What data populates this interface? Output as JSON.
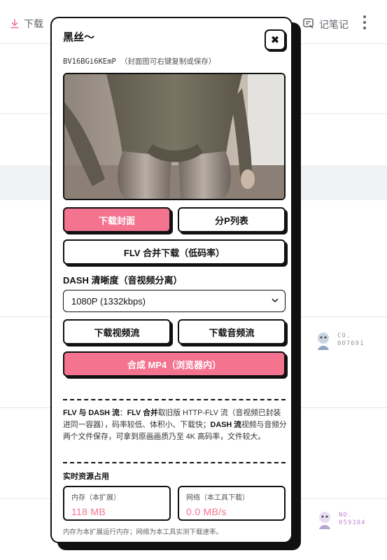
{
  "background": {
    "download_label": "下载",
    "notes_label": "记笔记",
    "badges": [
      {
        "line1": "CO.",
        "line2": "007691",
        "color": "#9499a0"
      },
      {
        "line1": "NO.",
        "line2": "059384",
        "color": "#c48ad8"
      }
    ]
  },
  "panel": {
    "title": "黑丝～",
    "close_symbol": "✖",
    "bvid": "BV16BGi6KEmP",
    "bvid_hint": "（封面图可右键复制或保存）",
    "buttons": {
      "download_cover": "下载封面",
      "p_list": "分P列表",
      "flv_merge": "FLV 合并下载（低码率）",
      "video_stream": "下载视频流",
      "audio_stream": "下载音频流",
      "compose_mp4": "合成 MP4（浏览器内）"
    },
    "dash_label": "DASH 清晰度（音视频分离）",
    "quality_selected": "1080P (1332kbps)",
    "note": {
      "t1": "FLV 与 DASH 流",
      "t2": "：",
      "t3": "FLV 合并",
      "t4": "取旧版 HTTP-FLV 流（音视频已封装进同一容器），码率较低、体积小、下载快；",
      "t5": "DASH 流",
      "t6": "视频与音频分两个文件保存，可拿到原画画质乃至 4K 高码率，文件较大。"
    },
    "resources_title": "实时资源占用",
    "memory_label": "内存（本扩展）",
    "memory_value": "118 MB",
    "network_label": "网络（本工具下载）",
    "network_value": "0.0 MB/s",
    "footnote": "内存为本扩展运行内存；网络为本工具实测下载速率。"
  },
  "colors": {
    "accent_pink": "#f4738f",
    "ink": "#111111"
  }
}
